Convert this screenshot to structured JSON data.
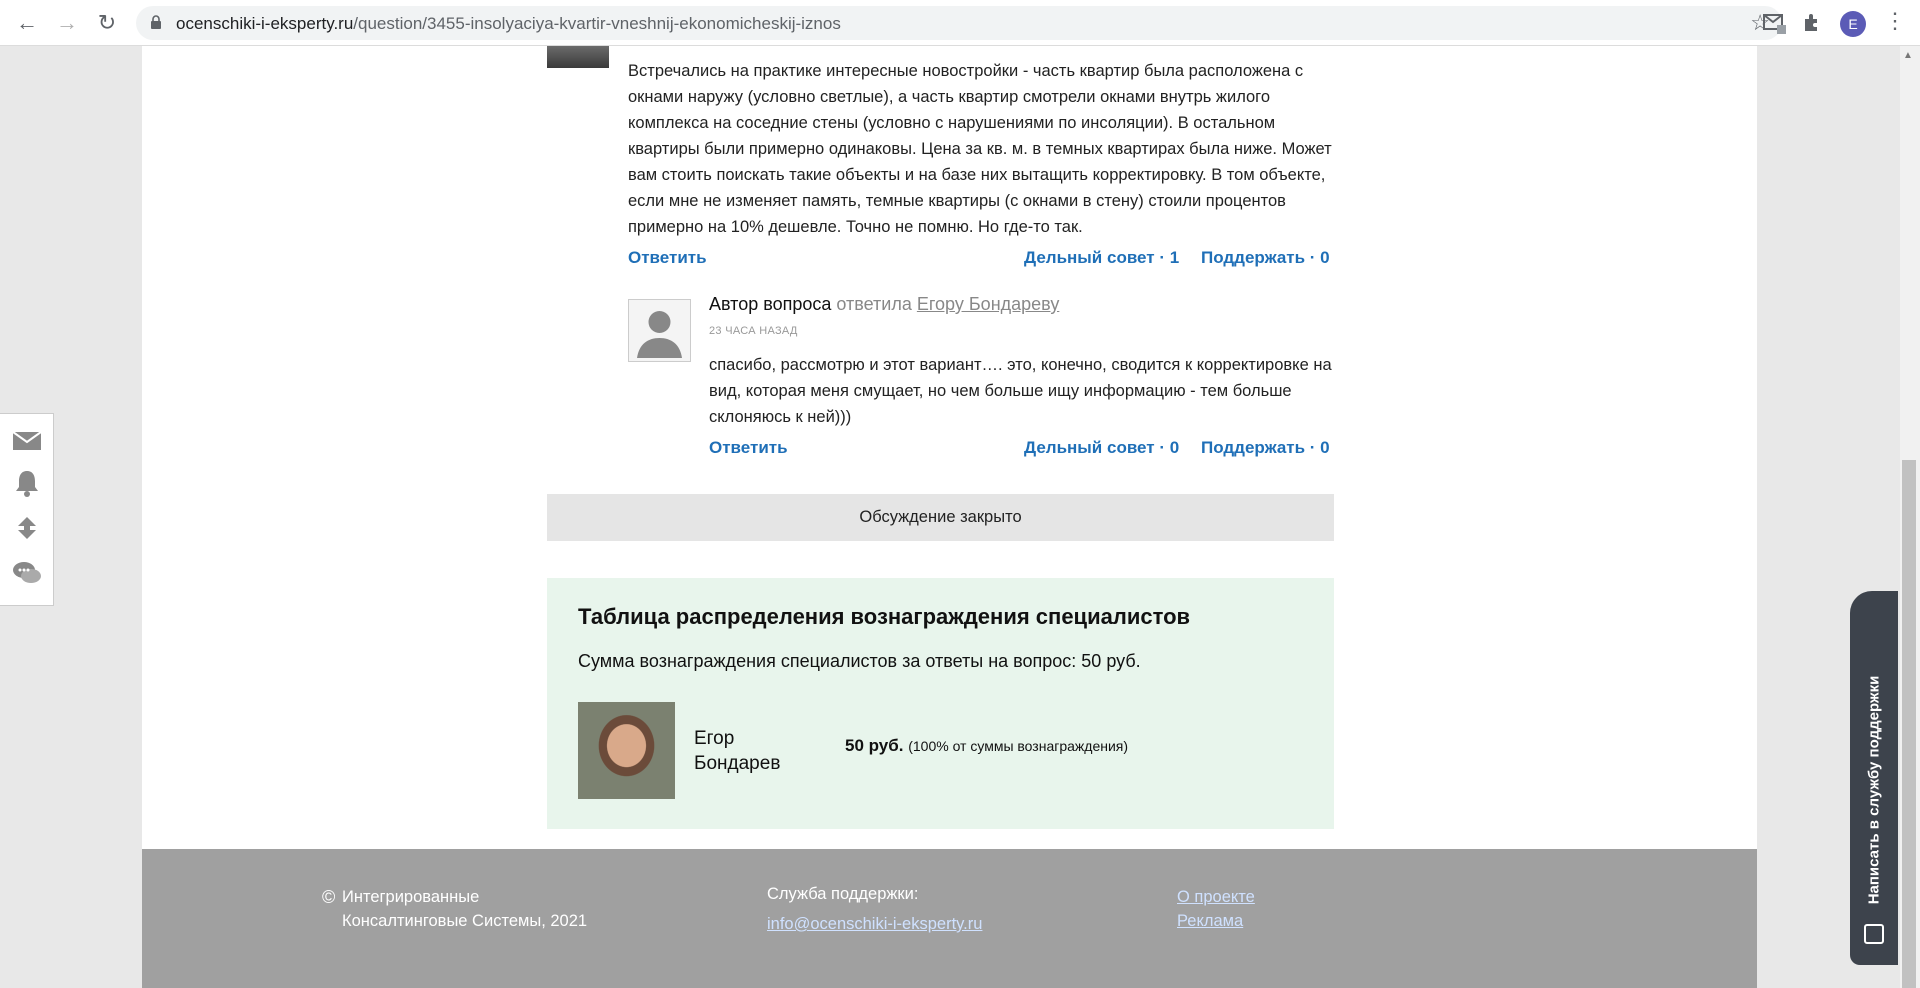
{
  "browser": {
    "url_domain": "ocenschiki-i-eksperty.ru",
    "url_path": "/question/3455-insolyaciya-kvartir-vneshnij-ekonomicheskij-iznos",
    "profile_letter": "E"
  },
  "comment": {
    "text": "Встречались на практике интересные новостройки - часть квартир была расположена с окнами наружу (условно светлые), а часть квартир смотрели окнами внутрь жилого комплекса на соседние стены (условно с нарушениями по инсоляции). В остальном квартиры были примерно одинаковы. Цена за кв. м. в темных квартирах была ниже. Может вам стоить поискать такие объекты и на базе них вытащить корректировку. В том объекте, если мне не изменяет память, темные квартиры (с окнами в стену) стоили процентов примерно на 10% дешевле. Точно не помню. Но где-то так.",
    "reply_label": "Ответить",
    "useful_label": "Дельный совет · 1",
    "support_label": "Поддержать · 0"
  },
  "reply": {
    "author": "Автор вопроса",
    "verb": "ответила",
    "to": "Егору Бондареву",
    "time": "23 ЧАСА НАЗАД",
    "text": "спасибо, рассмотрю и этот вариант…. это, конечно, сводится к корректировке на вид, которая меня смущает, но чем больше ищу информацию - тем больше склоняюсь к ней)))",
    "reply_label": "Ответить",
    "useful_label": "Дельный совет · 0",
    "support_label": "Поддержать · 0"
  },
  "closed": "Обсуждение закрыто",
  "reward": {
    "title": "Таблица распределения вознаграждения специалистов",
    "sum_text": "Сумма вознаграждения специалистов за ответы на вопрос: 50 руб.",
    "specialist_name": "Егор Бондарев",
    "amount": "50 руб.",
    "percent_text": "(100% от суммы вознаграждения)"
  },
  "footer": {
    "copyright_line1": "Интегрированные",
    "copyright_line2": "Консалтинговые Системы, 2021",
    "support_label": "Служба поддержки:",
    "support_email": "info@ocenschiki-i-eksperty.ru",
    "link_about": "О проекте",
    "link_ads": "Реклама"
  },
  "support_tab": "Написать в службу поддержки"
}
